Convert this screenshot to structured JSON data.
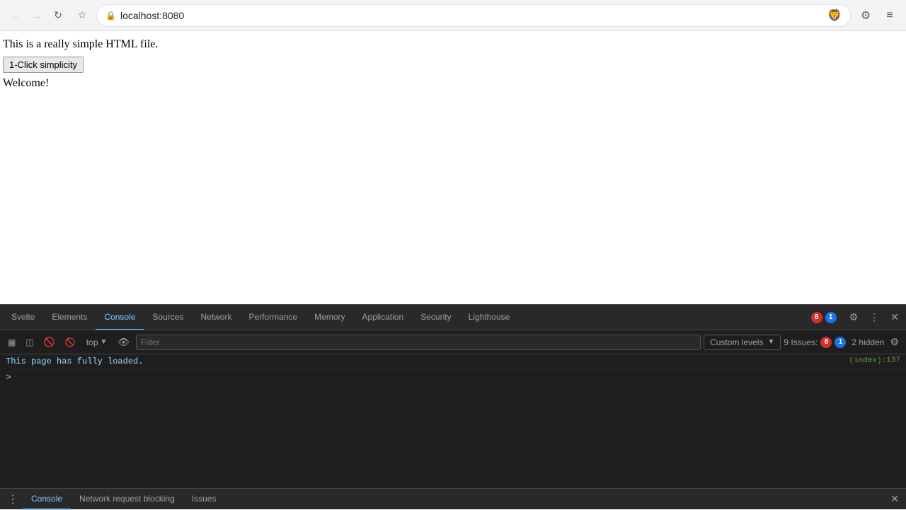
{
  "browser": {
    "back_title": "Back",
    "forward_title": "Forward",
    "reload_title": "Reload",
    "bookmark_title": "Bookmark",
    "address": "localhost:8080",
    "brave_icon": "🦁",
    "extensions_title": "Extensions",
    "menu_title": "Menu"
  },
  "page": {
    "text": "This is a really simple HTML file.",
    "button_label": "1-Click simplicity",
    "welcome": "Welcome!"
  },
  "devtools": {
    "tabs": [
      {
        "id": "svelte",
        "label": "Svelte"
      },
      {
        "id": "elements",
        "label": "Elements"
      },
      {
        "id": "console",
        "label": "Console"
      },
      {
        "id": "sources",
        "label": "Sources"
      },
      {
        "id": "network",
        "label": "Network"
      },
      {
        "id": "performance",
        "label": "Performance"
      },
      {
        "id": "memory",
        "label": "Memory"
      },
      {
        "id": "application",
        "label": "Application"
      },
      {
        "id": "security",
        "label": "Security"
      },
      {
        "id": "lighthouse",
        "label": "Lighthouse"
      }
    ],
    "active_tab": "console",
    "issues_label": "Issues:",
    "issues_error_count": "8",
    "issues_warn_count": "1",
    "settings_title": "Settings",
    "more_title": "More",
    "close_title": "Close DevTools"
  },
  "console": {
    "clear_btn": "🚫",
    "context_label": "top",
    "eye_icon": "👁",
    "filter_placeholder": "Filter",
    "custom_levels": "Custom levels",
    "issues_label": "9 Issues:",
    "error_count": "8",
    "warn_count": "1",
    "hidden_count": "2 hidden",
    "message": "This page has fully loaded.",
    "message_source": "(index):137",
    "prompt_symbol": ">"
  },
  "bottom_tabs": [
    {
      "id": "console",
      "label": "Console"
    },
    {
      "id": "network-request-blocking",
      "label": "Network request blocking"
    },
    {
      "id": "issues",
      "label": "Issues"
    }
  ],
  "bottom_active_tab": "console"
}
